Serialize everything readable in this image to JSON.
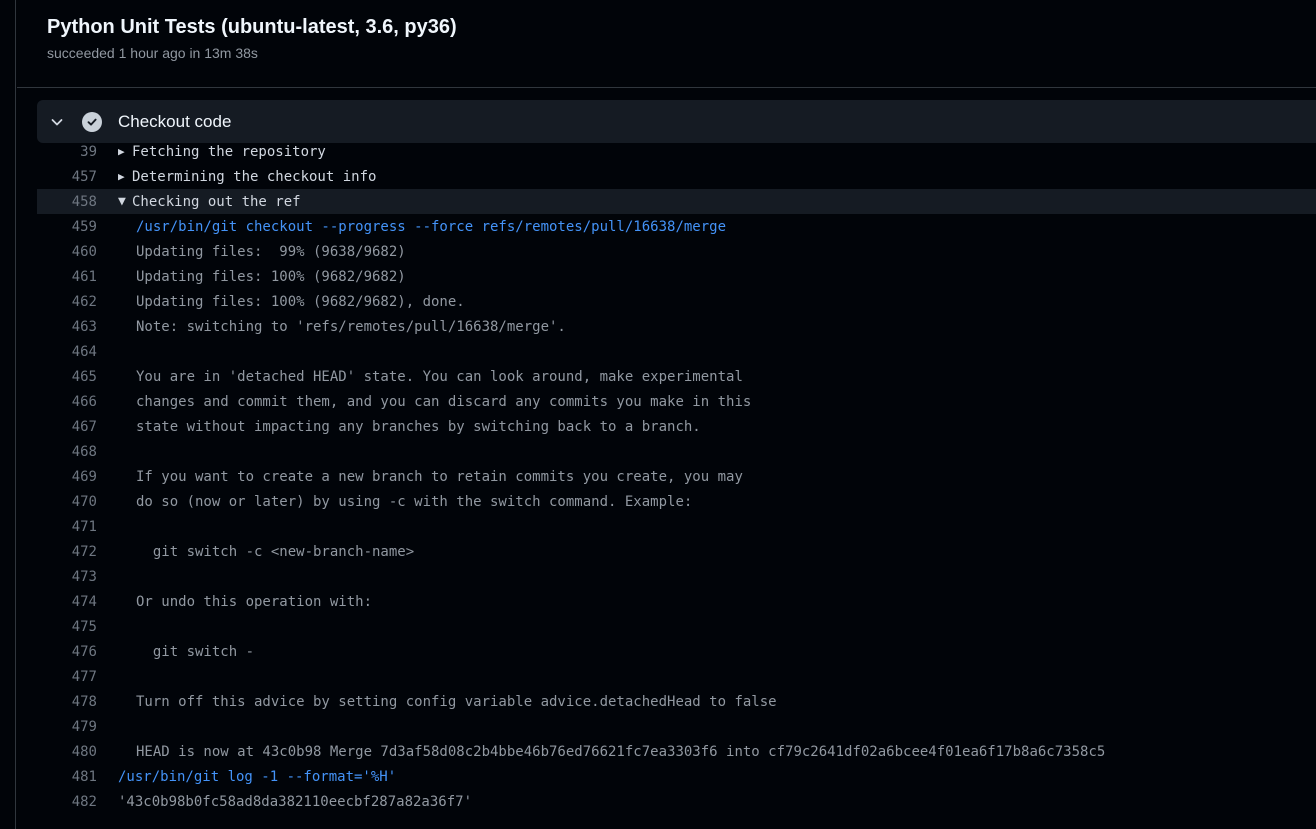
{
  "job": {
    "title": "Python Unit Tests (ubuntu-latest, 3.6, py36)",
    "subtitle": "succeeded 1 hour ago in 13m 38s"
  },
  "step": {
    "label": "Checkout code",
    "status": "success",
    "icon_chevron": "chevron-down-icon",
    "icon_status": "check-circle-icon"
  },
  "log": [
    {
      "num": "39",
      "text": "Fetching the repository",
      "kind": "group-collapsed"
    },
    {
      "num": "457",
      "text": "Determining the checkout info",
      "kind": "group-collapsed"
    },
    {
      "num": "458",
      "text": "Checking out the ref",
      "kind": "group-expanded"
    },
    {
      "num": "459",
      "text": "/usr/bin/git checkout --progress --force refs/remotes/pull/16638/merge",
      "kind": "cmd-indent"
    },
    {
      "num": "460",
      "text": "Updating files:  99% (9638/9682)",
      "kind": "out-indent"
    },
    {
      "num": "461",
      "text": "Updating files: 100% (9682/9682)",
      "kind": "out-indent"
    },
    {
      "num": "462",
      "text": "Updating files: 100% (9682/9682), done.",
      "kind": "out-indent"
    },
    {
      "num": "463",
      "text": "Note: switching to 'refs/remotes/pull/16638/merge'.",
      "kind": "out-indent"
    },
    {
      "num": "464",
      "text": "",
      "kind": "out-indent"
    },
    {
      "num": "465",
      "text": "You are in 'detached HEAD' state. You can look around, make experimental",
      "kind": "out-indent"
    },
    {
      "num": "466",
      "text": "changes and commit them, and you can discard any commits you make in this",
      "kind": "out-indent"
    },
    {
      "num": "467",
      "text": "state without impacting any branches by switching back to a branch.",
      "kind": "out-indent"
    },
    {
      "num": "468",
      "text": "",
      "kind": "out-indent"
    },
    {
      "num": "469",
      "text": "If you want to create a new branch to retain commits you create, you may",
      "kind": "out-indent"
    },
    {
      "num": "470",
      "text": "do so (now or later) by using -c with the switch command. Example:",
      "kind": "out-indent"
    },
    {
      "num": "471",
      "text": "",
      "kind": "out-indent"
    },
    {
      "num": "472",
      "text": "  git switch -c <new-branch-name>",
      "kind": "out-indent"
    },
    {
      "num": "473",
      "text": "",
      "kind": "out-indent"
    },
    {
      "num": "474",
      "text": "Or undo this operation with:",
      "kind": "out-indent"
    },
    {
      "num": "475",
      "text": "",
      "kind": "out-indent"
    },
    {
      "num": "476",
      "text": "  git switch -",
      "kind": "out-indent"
    },
    {
      "num": "477",
      "text": "",
      "kind": "out-indent"
    },
    {
      "num": "478",
      "text": "Turn off this advice by setting config variable advice.detachedHead to false",
      "kind": "out-indent"
    },
    {
      "num": "479",
      "text": "",
      "kind": "out-indent"
    },
    {
      "num": "480",
      "text": "HEAD is now at 43c0b98 Merge 7d3af58d08c2b4bbe46b76ed76621fc7ea3303f6 into cf79c2641df02a6bcee4f01ea6f17b8a6c7358c5",
      "kind": "out-indent"
    },
    {
      "num": "481",
      "text": "/usr/bin/git log -1 --format='%H'",
      "kind": "cmd"
    },
    {
      "num": "482",
      "text": "'43c0b98b0fc58ad8da382110eecbf287a82a36f7'",
      "kind": "out"
    }
  ],
  "colors": {
    "background": "#010409",
    "command": "#4493f8",
    "output": "#9198a1",
    "line_number": "#6e7681"
  }
}
